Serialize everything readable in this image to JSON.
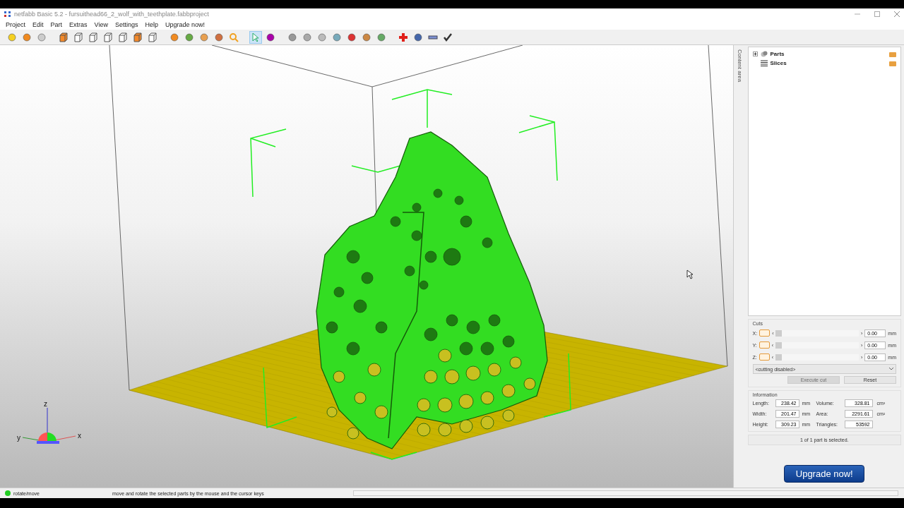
{
  "window": {
    "title": "netfabb Basic 5.2 - fursuithead66_2_wolf_with_teethplate.fabbproject"
  },
  "menu": [
    "Project",
    "Edit",
    "Part",
    "Extras",
    "View",
    "Settings",
    "Help",
    "Upgrade now!"
  ],
  "viewport": {
    "axes": {
      "z": "z",
      "y": "y",
      "x": "x"
    }
  },
  "side_tab": {
    "label": "Content area"
  },
  "tree": [
    {
      "label": "Parts",
      "kind": "parts",
      "expanded": false
    },
    {
      "label": "Slices",
      "kind": "slices"
    }
  ],
  "cuts": {
    "title": "Cuts",
    "axes": [
      {
        "label": "X:",
        "prev": "‹",
        "level": 0,
        "next": "›",
        "value": "0.00",
        "unit": "mm"
      },
      {
        "label": "Y:",
        "prev": "‹",
        "level": 0,
        "next": "›",
        "value": "0.00",
        "unit": "mm"
      },
      {
        "label": "Z:",
        "prev": "‹",
        "level": 0,
        "next": "›",
        "value": "0.00",
        "unit": "mm"
      }
    ],
    "mode": "<cutting disabled>",
    "buttons": [
      {
        "label": "Execute cut",
        "disabled": true
      },
      {
        "label": "Reset",
        "disabled": false
      }
    ]
  },
  "information": {
    "title": "Information",
    "fields": [
      {
        "label": "Length:",
        "value": "238.42",
        "unit": "mm"
      },
      {
        "label": "Volume:",
        "value": "328.81",
        "unit": "cm³"
      },
      {
        "label": "Width:",
        "value": "201.47",
        "unit": "mm"
      },
      {
        "label": "Area:",
        "value": "2291.61",
        "unit": "cm²"
      },
      {
        "label": "Height:",
        "value": "309.23",
        "unit": "mm"
      },
      {
        "label": "Triangles:",
        "value": "53592"
      }
    ]
  },
  "selection": "1 of 1 part is selected.",
  "upgrade_button": "Upgrade now!",
  "status_bar": {
    "mode": "rotate/move",
    "color": "#22cc22",
    "message": "move and rotate the selected parts by the mouse and the cursor keys",
    "progress": {
      "level": 0
    }
  }
}
